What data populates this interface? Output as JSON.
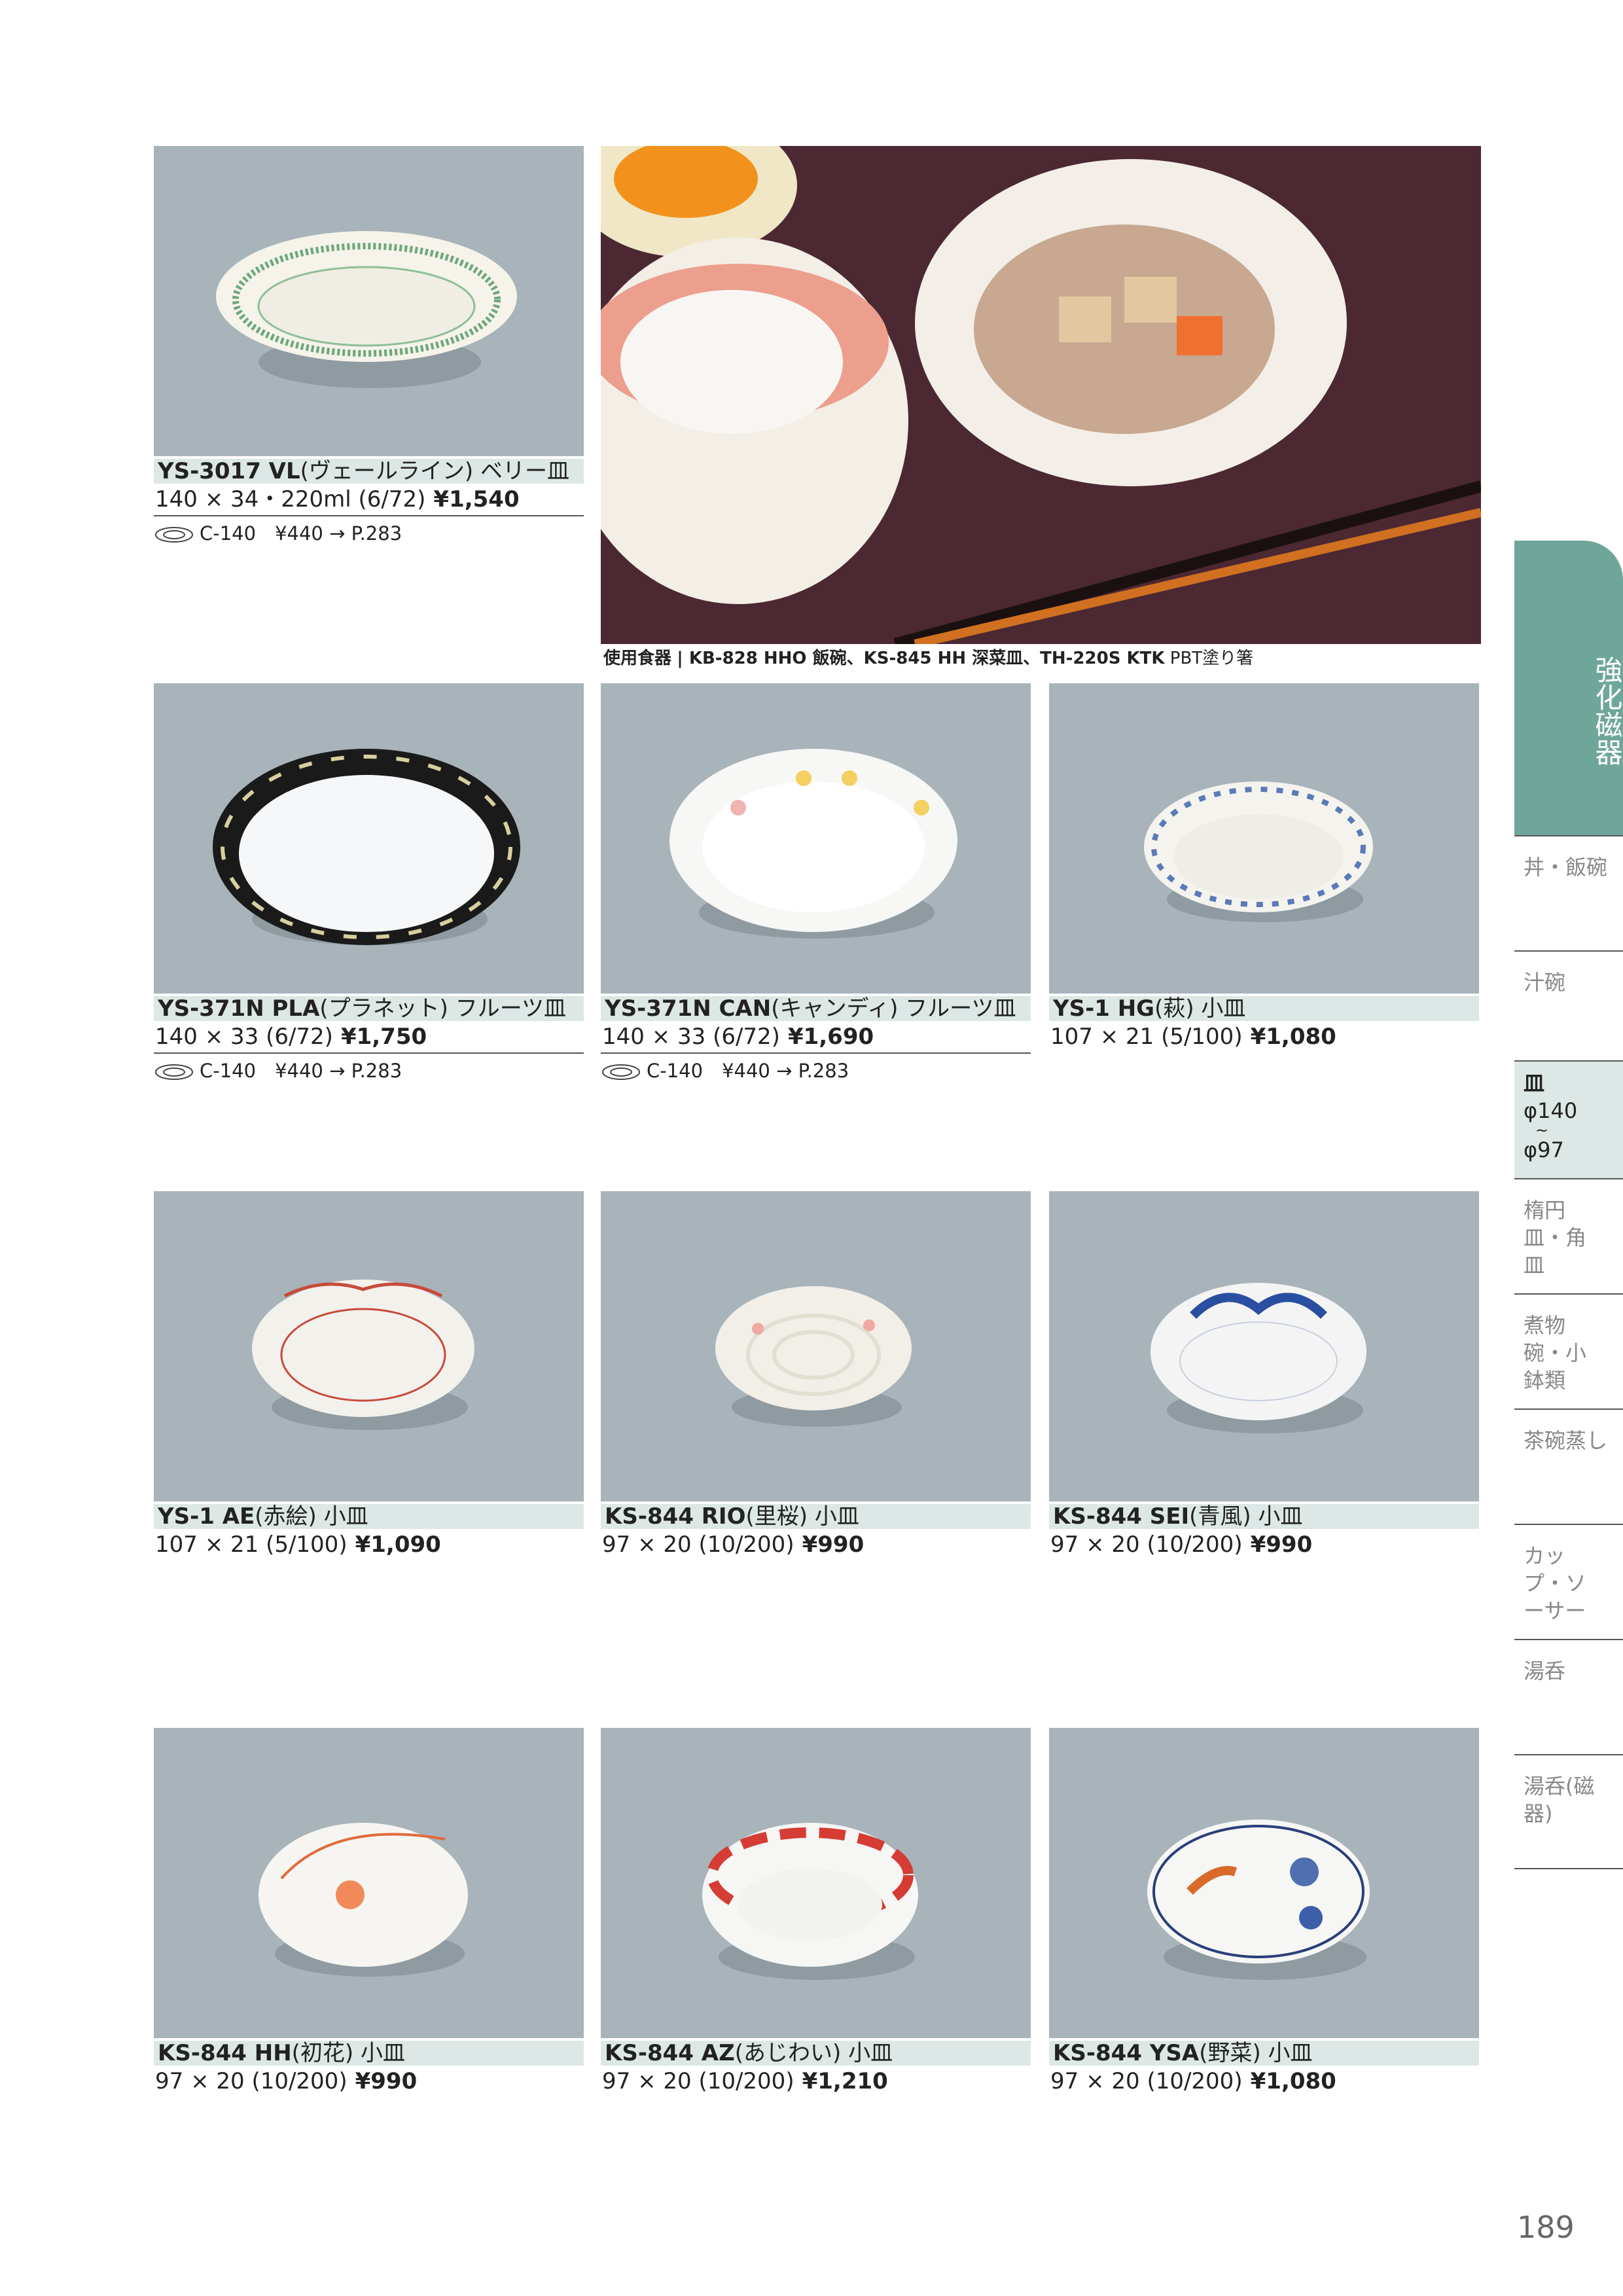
{
  "products": [
    {
      "title": "YS-3017 VL",
      "sub": "(ヴェールライン) ベリー皿",
      "spec": "140 × 34・220ml (6/72)",
      "price": "¥1,540",
      "acc": "C-140　¥440 → P.283"
    },
    {
      "title": "YS-371N PLA",
      "sub": "(プラネット) フルーツ皿",
      "spec": "140 × 33 (6/72)",
      "price": "¥1,750",
      "acc": "C-140　¥440 → P.283"
    },
    {
      "title": "YS-371N CAN",
      "sub": "(キャンディ) フルーツ皿",
      "spec": "140 × 33 (6/72)",
      "price": "¥1,690",
      "acc": "C-140　¥440 → P.283"
    },
    {
      "title": "YS-1 HG",
      "sub": "(萩) 小皿",
      "spec": "107 × 21 (5/100)",
      "price": "¥1,080",
      "acc": ""
    },
    {
      "title": "YS-1 AE",
      "sub": "(赤絵) 小皿",
      "spec": "107 × 21 (5/100)",
      "price": "¥1,090",
      "acc": ""
    },
    {
      "title": "KS-844 RIO",
      "sub": "(里桜) 小皿",
      "spec": "97 × 20 (10/200)",
      "price": "¥990",
      "acc": ""
    },
    {
      "title": "KS-844 SEI",
      "sub": "(青風) 小皿",
      "spec": "97 × 20 (10/200)",
      "price": "¥990",
      "acc": ""
    },
    {
      "title": "KS-844 HH",
      "sub": "(初花) 小皿",
      "spec": "97 × 20 (10/200)",
      "price": "¥990",
      "acc": ""
    },
    {
      "title": "KS-844 AZ",
      "sub": "(あじわい) 小皿",
      "spec": "97 × 20 (10/200)",
      "price": "¥1,210",
      "acc": ""
    },
    {
      "title": "KS-844 YSA",
      "sub": "(野菜) 小皿",
      "spec": "97 × 20 (10/200)",
      "price": "¥1,080",
      "acc": ""
    }
  ],
  "caption": {
    "label": "使用食器",
    "items": "| KB-828 HHO 飯碗、KS-845 HH 深菜皿、TH-220S KTK",
    "tail": "PBT塗り箸"
  },
  "sidebar": {
    "active": "強化磁器",
    "items": [
      "丼・飯碗",
      "汁碗",
      "楕円皿・角皿",
      "煮物碗・小鉢類",
      "茶碗蒸し",
      "カップ・ソーサー",
      "湯呑",
      "湯呑(磁器)"
    ],
    "current": {
      "label": "皿",
      "range_top": "φ140",
      "range_sep": "~",
      "range_bottom": "φ97"
    }
  },
  "page_number": "189"
}
